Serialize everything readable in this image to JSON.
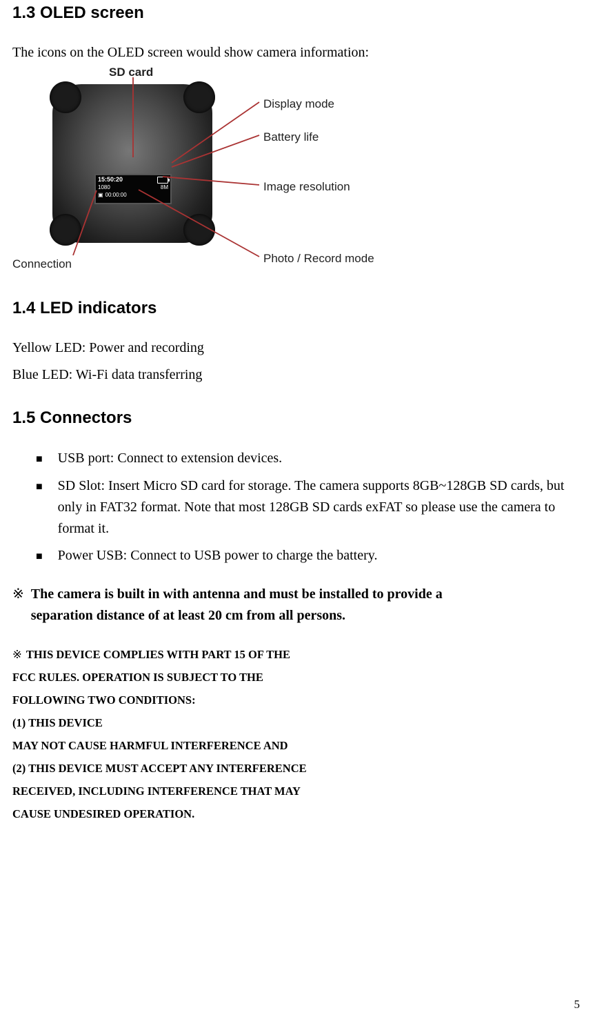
{
  "s13": {
    "heading": "1.3 OLED screen",
    "intro": "The icons on the OLED screen would show camera information:"
  },
  "diagram": {
    "sd": "SD card",
    "display": "Display mode",
    "battery": "Battery life",
    "resolution": "Image  resolution",
    "mode": "Photo / Record mode",
    "connection": "Connection",
    "oled_time": "15:50:20",
    "oled_1080": "1080",
    "oled_8m": "8M",
    "oled_zero": "00:00:00"
  },
  "s14": {
    "heading": "1.4 LED indicators",
    "yellow": "Yellow LED: Power and recording",
    "blue": "Blue LED: Wi-Fi data transferring"
  },
  "s15": {
    "heading": "1.5 Connectors",
    "items": [
      "USB port: Connect to extension devices.",
      "SD Slot: Insert Micro SD card for storage. The camera supports 8GB~128GB SD cards, but only in FAT32 format. Note that most 128GB SD cards exFAT so please use the camera to format it.",
      "Power USB: Connect to USB power to charge the battery."
    ]
  },
  "note": {
    "sym": "※",
    "line1": "The camera is built in with antenna and must be installed to provide a",
    "line2": "separation distance of at least 20 cm from all persons."
  },
  "fcc": {
    "sym": "※",
    "lines": [
      "THIS DEVICE COMPLIES WITH PART 15 OF THE",
      "FCC RULES. OPERATION IS SUBJECT TO THE",
      "FOLLOWING TWO CONDITIONS:",
      "(1) THIS DEVICE",
      "MAY NOT CAUSE HARMFUL INTERFERENCE AND",
      "(2) THIS DEVICE MUST ACCEPT ANY INTERFERENCE",
      "RECEIVED, INCLUDING INTERFERENCE THAT MAY",
      "CAUSE UNDESIRED OPERATION."
    ]
  },
  "page": "5"
}
